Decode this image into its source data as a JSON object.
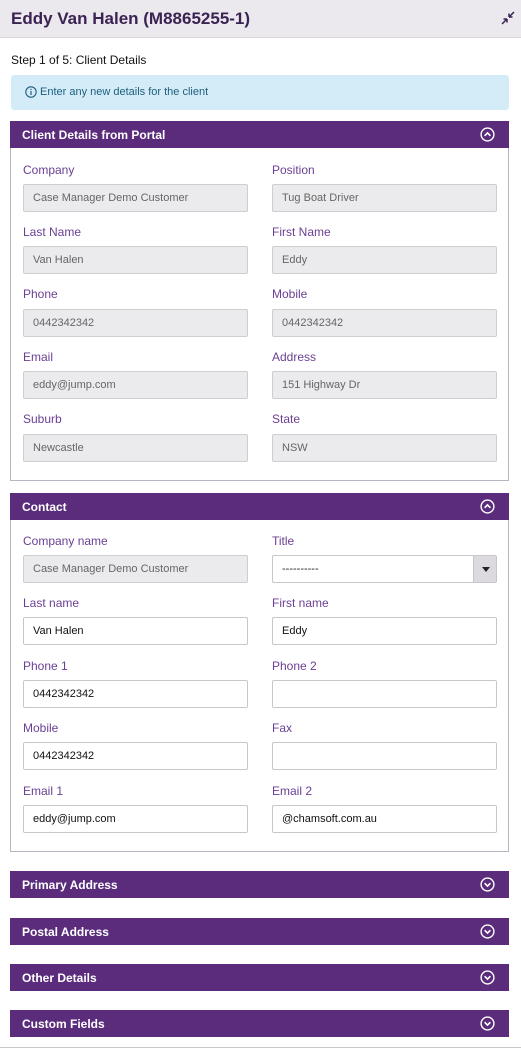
{
  "header": {
    "title": "Eddy Van Halen (M8865255-1)"
  },
  "step": "Step 1 of 5: Client Details",
  "info": {
    "text": "Enter any new details for the client"
  },
  "portal": {
    "title": "Client Details from Portal",
    "company_label": "Company",
    "company_value": "Case Manager Demo Customer",
    "position_label": "Position",
    "position_value": "Tug Boat Driver",
    "last_name_label": "Last Name",
    "last_name_value": "Van Halen",
    "first_name_label": "First Name",
    "first_name_value": "Eddy",
    "phone_label": "Phone",
    "phone_value": "0442342342",
    "mobile_label": "Mobile",
    "mobile_value": "0442342342",
    "email_label": "Email",
    "email_value": "eddy@jump.com",
    "address_label": "Address",
    "address_value": "151 Highway Dr",
    "suburb_label": "Suburb",
    "suburb_value": "Newcastle",
    "state_label": "State",
    "state_value": "NSW"
  },
  "contact": {
    "title": "Contact",
    "company_name_label": "Company name",
    "company_name_value": "Case Manager Demo Customer",
    "title_label": "Title",
    "title_value": "----------",
    "last_name_label": "Last name",
    "last_name_value": "Van Halen",
    "first_name_label": "First name",
    "first_name_value": "Eddy",
    "phone1_label": "Phone 1",
    "phone1_value": "0442342342",
    "phone2_label": "Phone 2",
    "phone2_value": "",
    "mobile_label": "Mobile",
    "mobile_value": "0442342342",
    "fax_label": "Fax",
    "fax_value": "",
    "email1_label": "Email 1",
    "email1_value": "eddy@jump.com",
    "email2_label": "Email 2",
    "email2_value": "@chamsoft.com.au"
  },
  "sections": {
    "primary_address": "Primary Address",
    "postal_address": "Postal Address",
    "other_details": "Other Details",
    "custom_fields": "Custom Fields"
  },
  "colors": {
    "accent": "#5a2c7b",
    "label": "#6a3f94",
    "info_bg": "#d4ecf8",
    "title_bg": "#ebe9ee"
  },
  "icons": {
    "info": "info-circle-icon",
    "expanded": "chevron-up-circle-icon",
    "collapsed": "chevron-down-circle-icon",
    "resize": "collapse-arrows-icon"
  }
}
